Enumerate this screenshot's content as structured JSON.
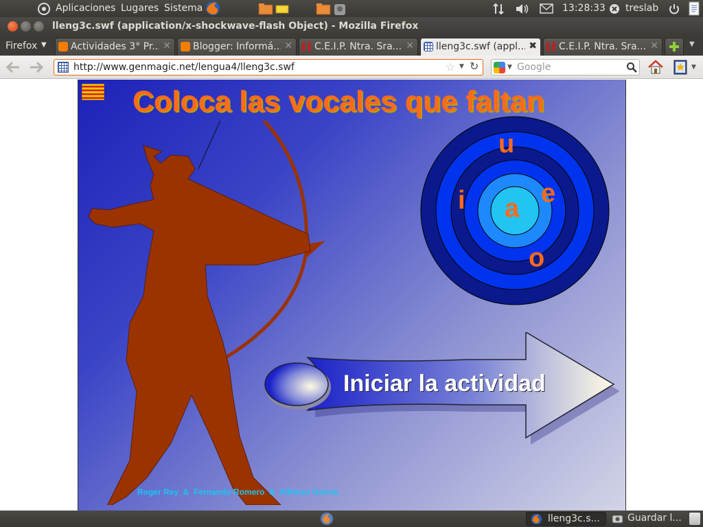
{
  "panel": {
    "menu": [
      "Aplicaciones",
      "Lugares",
      "Sistema"
    ],
    "clock": "13:28:33",
    "user": "treslab"
  },
  "window": {
    "title": "lleng3c.swf (application/x-shockwave-flash Object) - Mozilla Firefox"
  },
  "tabs": {
    "firefox_button": "Firefox",
    "items": [
      {
        "label": "Actividades 3° Pr...",
        "favicon": "blogger-icon"
      },
      {
        "label": "Blogger: Informá...",
        "favicon": "blogger-icon"
      },
      {
        "label": "C.E.I.P. Ntra. Sra....",
        "favicon": "page-icon"
      },
      {
        "label": "lleng3c.swf (appl...",
        "favicon": "page-icon",
        "active": true
      },
      {
        "label": "C.E.I.P. Ntra. Sra....",
        "favicon": "page-icon"
      }
    ]
  },
  "navbar": {
    "url": "http://www.genmagic.net/lengua4/lleng3c.swf",
    "search_placeholder": "Google"
  },
  "flash": {
    "title": "Coloca las vocales que faltan",
    "target_letters": {
      "center": "a",
      "top": "u",
      "left": "i",
      "right": "e",
      "bottom": "o"
    },
    "start_button": "Iniciar la actividad",
    "credits": "Roger Rey  &  Fernando Romero  &  Alfonso García"
  },
  "taskbar": {
    "items": [
      "lleng3c.s...",
      "Guardar l..."
    ]
  },
  "colors": {
    "title_orange": "#ff6a1a",
    "archer": "#9b3300",
    "ring_dark": "#0a1a8c",
    "ring_mid": "#0033ee",
    "ring_light": "#1e88ff",
    "bullseye": "#22c4f2"
  }
}
